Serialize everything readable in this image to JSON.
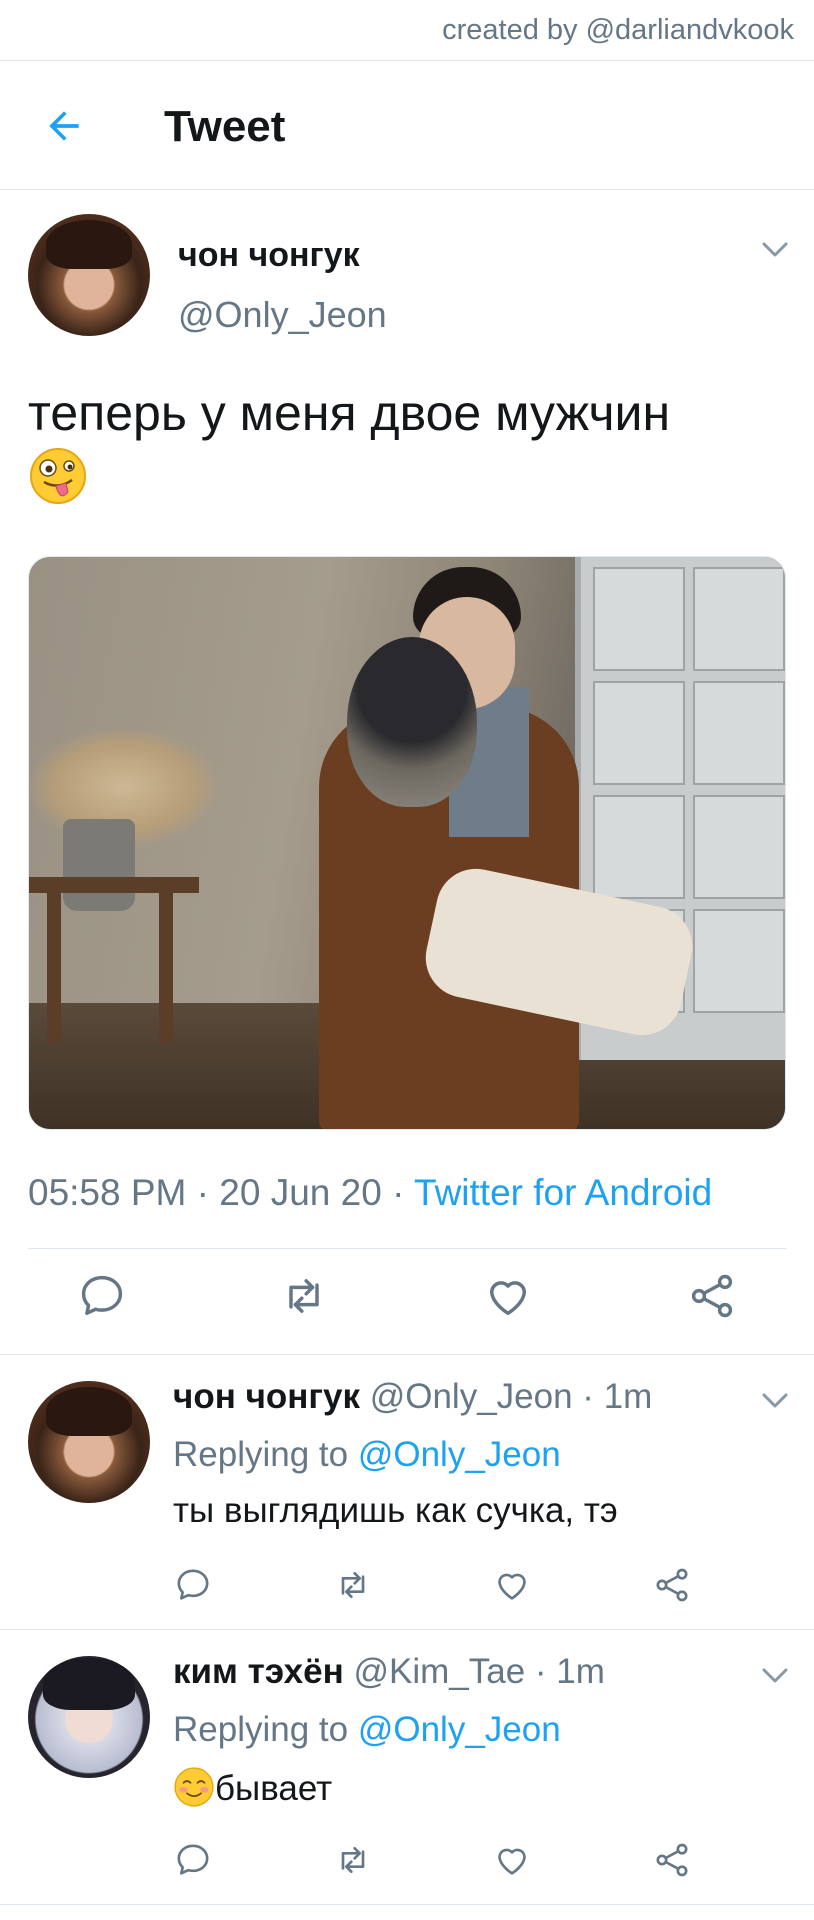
{
  "credit": "created by @darliandvkook",
  "header": {
    "title": "Tweet",
    "back_icon": "arrow-left-icon"
  },
  "colors": {
    "accent": "#1da1f2",
    "secondary_text": "#657786",
    "divider": "#e1e8ed"
  },
  "main_tweet": {
    "name": "чон чонгук",
    "handle": "@Only_Jeon",
    "text": "теперь у меня двое мужчин",
    "emoji": "zany-face-emoji",
    "time": "05:58 PM",
    "date": "20 Jun 20",
    "separator": " · ",
    "source": "Twitter for Android",
    "actions": [
      "reply-icon",
      "retweet-icon",
      "like-icon",
      "share-icon"
    ]
  },
  "replies": [
    {
      "name": "чон чонгук",
      "handle": "@Only_Jeon",
      "age": "1m",
      "replying_prefix": "Replying to ",
      "replying_to": "@Only_Jeon",
      "text": "ты выглядишь как сучка, тэ"
    },
    {
      "name": "ким тэхён",
      "handle": "@Kim_Tae",
      "age": "1m",
      "replying_prefix": "Replying to ",
      "replying_to": "@Only_Jeon",
      "emoji": "smiling-face-emoji",
      "text": "бывает"
    }
  ]
}
